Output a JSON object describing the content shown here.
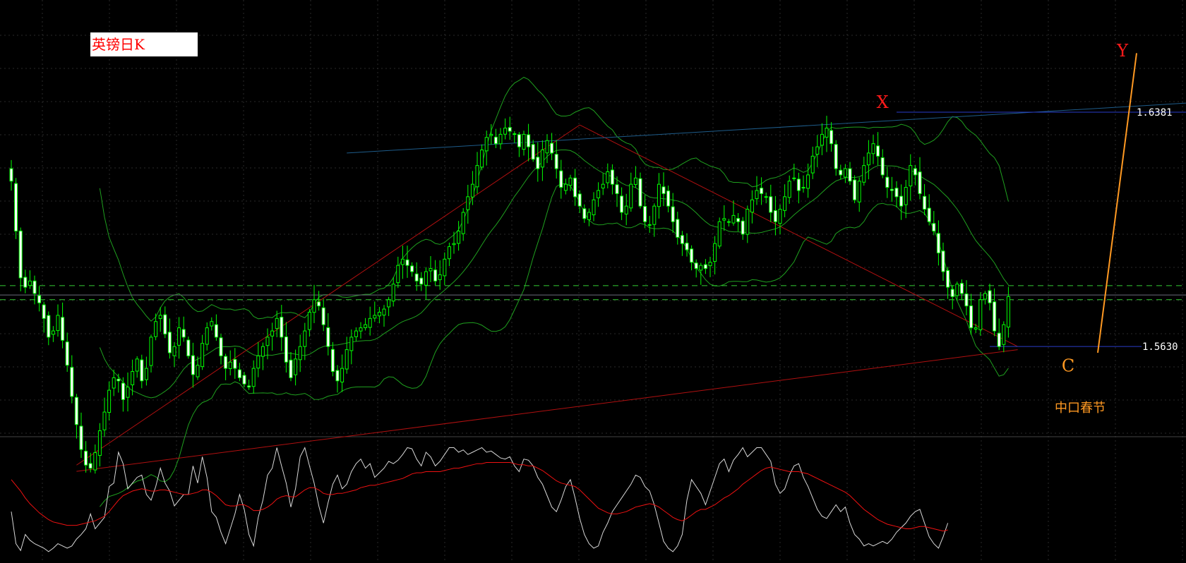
{
  "title": "英镑日K",
  "colors": {
    "background": "#000000",
    "grid": "#2a2a2a",
    "candle": "#00ff00",
    "candle_body_up": "#000000",
    "candle_body_down": "#ffffff",
    "bollinger": "#1fa01f",
    "trendline_red": "#b01010",
    "trendline_blue": "#1e5c8a",
    "level_blue": "#2a3cc8",
    "dashed_green": "#33cc33",
    "orange": "#ff9922",
    "red_label": "#ff1a1a",
    "stoch_main": "#d8d8d8",
    "stoch_signal": "#ee1111",
    "price_label": "#ffffff"
  },
  "chart_data": [
    {
      "type": "candlestick",
      "title": "英镑日K",
      "price_range": [
        1.535,
        1.665
      ],
      "levels": [
        {
          "name": "upper-level",
          "value": 1.6381,
          "label": "1.6381"
        },
        {
          "name": "lower-level",
          "value": 1.563,
          "label": "1.5630"
        }
      ],
      "annotations": [
        {
          "name": "label-x",
          "text": "X",
          "bar": 187,
          "price": 1.6395
        },
        {
          "name": "label-y",
          "text": "Y",
          "bar": 225,
          "price": 1.656
        },
        {
          "name": "label-c",
          "text": "C",
          "bar": 225,
          "price": 1.555
        },
        {
          "name": "label-spring-festival",
          "text": "中口春节",
          "bar": 225,
          "price": 1.542
        }
      ],
      "closes": [
        1.616,
        1.6,
        1.585,
        1.582,
        1.584,
        1.58,
        1.577,
        1.572,
        1.566,
        1.568,
        1.573,
        1.565,
        1.557,
        1.547,
        1.538,
        1.53,
        1.525,
        1.524,
        1.529,
        1.536,
        1.542,
        1.549,
        1.553,
        1.552,
        1.546,
        1.55,
        1.555,
        1.559,
        1.552,
        1.556,
        1.566,
        1.571,
        1.573,
        1.567,
        1.561,
        1.563,
        1.569,
        1.566,
        1.56,
        1.554,
        1.557,
        1.564,
        1.569,
        1.571,
        1.566,
        1.56,
        1.556,
        1.558,
        1.556,
        1.553,
        1.551,
        1.55,
        1.556,
        1.56,
        1.563,
        1.566,
        1.568,
        1.572,
        1.566,
        1.558,
        1.553,
        1.559,
        1.563,
        1.568,
        1.574,
        1.578,
        1.576,
        1.57,
        1.563,
        1.555,
        1.552,
        1.556,
        1.562,
        1.566,
        1.568,
        1.569,
        1.57,
        1.572,
        1.573,
        1.574,
        1.575,
        1.578,
        1.583,
        1.589,
        1.591,
        1.589,
        1.587,
        1.584,
        1.583,
        1.587,
        1.588,
        1.584,
        1.586,
        1.591,
        1.595,
        1.596,
        1.6,
        1.606,
        1.611,
        1.615,
        1.621,
        1.626,
        1.63,
        1.631,
        1.628,
        1.631,
        1.633,
        1.632,
        1.631,
        1.627,
        1.631,
        1.627,
        1.623,
        1.62,
        1.626,
        1.629,
        1.625,
        1.62,
        1.614,
        1.615,
        1.617,
        1.611,
        1.608,
        1.604,
        1.606,
        1.61,
        1.613,
        1.615,
        1.619,
        1.615,
        1.612,
        1.606,
        1.608,
        1.615,
        1.617,
        1.608,
        1.603,
        1.602,
        1.608,
        1.615,
        1.612,
        1.608,
        1.603,
        1.598,
        1.596,
        1.594,
        1.59,
        1.588,
        1.589,
        1.588,
        1.59,
        1.596,
        1.603,
        1.604,
        1.603,
        1.605,
        1.603,
        1.599,
        1.607,
        1.61,
        1.613,
        1.612,
        1.611,
        1.606,
        1.603,
        1.607,
        1.611,
        1.616,
        1.617,
        1.613,
        1.614,
        1.618,
        1.624,
        1.627,
        1.631,
        1.633,
        1.628,
        1.62,
        1.618,
        1.62,
        1.616,
        1.61,
        1.616,
        1.621,
        1.625,
        1.628,
        1.624,
        1.618,
        1.614,
        1.613,
        1.611,
        1.608,
        1.614,
        1.621,
        1.618,
        1.612,
        1.607,
        1.603,
        1.6,
        1.593,
        1.587,
        1.582,
        1.579,
        1.583,
        1.58,
        1.576,
        1.569,
        1.569,
        1.578,
        1.58,
        1.577,
        1.568,
        1.563,
        1.57,
        1.579
      ]
    },
    {
      "type": "line",
      "name": "stochastic-oscillator",
      "ylim": [
        0,
        100
      ],
      "series": [
        {
          "name": "main",
          "values": [
            40,
            12,
            6,
            20,
            15,
            12,
            10,
            8,
            5,
            8,
            12,
            10,
            8,
            10,
            16,
            20,
            25,
            38,
            25,
            30,
            35,
            62,
            65,
            92,
            82,
            60,
            65,
            70,
            72,
            55,
            50,
            62,
            78,
            65,
            58,
            45,
            50,
            55,
            55,
            80,
            65,
            88,
            70,
            40,
            35,
            22,
            12,
            25,
            38,
            55,
            42,
            20,
            10,
            35,
            50,
            72,
            78,
            96,
            80,
            65,
            44,
            60,
            88,
            96,
            80,
            65,
            45,
            30,
            48,
            64,
            72,
            60,
            64,
            75,
            82,
            86,
            78,
            82,
            70,
            74,
            78,
            84,
            82,
            85,
            90,
            96,
            95,
            86,
            80,
            92,
            88,
            80,
            84,
            90,
            96,
            96,
            92,
            94,
            90,
            92,
            94,
            96,
            92,
            93,
            90,
            87,
            86,
            88,
            80,
            75,
            86,
            85,
            80,
            70,
            64,
            54,
            44,
            40,
            50,
            62,
            68,
            52,
            34,
            20,
            12,
            8,
            10,
            22,
            30,
            40,
            46,
            52,
            58,
            64,
            72,
            70,
            62,
            58,
            46,
            30,
            14,
            8,
            5,
            10,
            20,
            50,
            68,
            62,
            56,
            46,
            58,
            70,
            82,
            86,
            75,
            85,
            90,
            96,
            88,
            92,
            96,
            96,
            90,
            84,
            64,
            56,
            60,
            72,
            80,
            82,
            70,
            62,
            52,
            42,
            36,
            34,
            40,
            46,
            40,
            44,
            30,
            20,
            16,
            10,
            12,
            10,
            12,
            14,
            12,
            16,
            22,
            26,
            30,
            36,
            40,
            42,
            30,
            18,
            12,
            8,
            18,
            30
          ]
        },
        {
          "name": "signal",
          "values": [
            68,
            63,
            58,
            52,
            47,
            43,
            39,
            36,
            33,
            31,
            30,
            29,
            28,
            28,
            28,
            29,
            30,
            31,
            32,
            34,
            36,
            40,
            45,
            50,
            54,
            56,
            58,
            59,
            60,
            59,
            58,
            58,
            59,
            59,
            58,
            57,
            56,
            55,
            55,
            56,
            57,
            59,
            59,
            57,
            54,
            50,
            46,
            45,
            45,
            46,
            46,
            44,
            41,
            41,
            42,
            44,
            47,
            51,
            53,
            54,
            53,
            53,
            56,
            59,
            61,
            61,
            59,
            56,
            55,
            55,
            56,
            56,
            57,
            58,
            59,
            61,
            62,
            63,
            63,
            64,
            65,
            66,
            67,
            68,
            69,
            71,
            73,
            74,
            74,
            75,
            75,
            75,
            75,
            76,
            77,
            78,
            78,
            79,
            80,
            81,
            82,
            82,
            83,
            83,
            83,
            83,
            83,
            83,
            82,
            81,
            81,
            80,
            80,
            78,
            76,
            73,
            70,
            67,
            65,
            64,
            63,
            62,
            59,
            55,
            51,
            47,
            43,
            41,
            39,
            38,
            38,
            39,
            40,
            42,
            44,
            45,
            46,
            47,
            46,
            44,
            41,
            38,
            35,
            33,
            32,
            34,
            37,
            40,
            42,
            42,
            44,
            46,
            49,
            52,
            54,
            57,
            60,
            64,
            67,
            70,
            73,
            76,
            78,
            79,
            78,
            77,
            76,
            75,
            75,
            75,
            74,
            73,
            71,
            69,
            67,
            65,
            63,
            61,
            59,
            57,
            54,
            50,
            46,
            42,
            39,
            36,
            33,
            31,
            29,
            28,
            27,
            26,
            25,
            25,
            26,
            27,
            27,
            26,
            25,
            24,
            23,
            24
          ]
        }
      ]
    }
  ]
}
